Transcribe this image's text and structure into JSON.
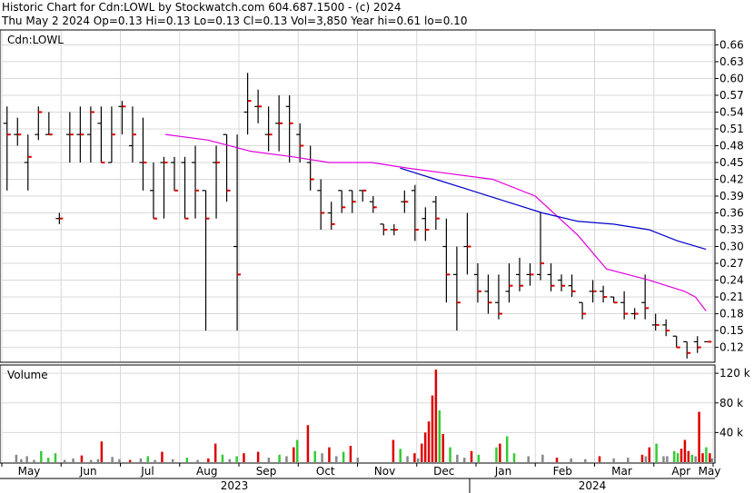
{
  "header": {
    "line1": "Historic Chart for Cdn:LOWL by Stockwatch.com 604.687.1500 - (c) 2024",
    "line2": "Thu May  2 2024  Op=0.13  Hi=0.13  Lo=0.13  Cl=0.13  Vol=3,850  Year hi=0.61  lo=0.10"
  },
  "colors": {
    "background": "#ffffff",
    "grid": "#d8d8d8",
    "price_bar": "#000000",
    "close_tick": "#dd0000",
    "ma_short": "#e000e0",
    "ma_long": "#0000cc",
    "volume_up": "#33cc33",
    "volume_down": "#dd0000",
    "volume_flat": "#888888"
  },
  "chart_data": [
    {
      "type": "ohlc",
      "title": "Cdn:LOWL",
      "y_axis_side": "right",
      "ylim": [
        0.095,
        0.685
      ],
      "y_ticks": [
        "0.66",
        "0.63",
        "0.60",
        "0.57",
        "0.54",
        "0.51",
        "0.48",
        "0.45",
        "0.42",
        "0.39",
        "0.36",
        "0.33",
        "0.30",
        "0.27",
        "0.24",
        "0.21",
        "0.18",
        "0.15",
        "0.12"
      ],
      "grid": true,
      "x_months": [
        "May",
        "Jun",
        "Jul",
        "Aug",
        "Sep",
        "Oct",
        "Nov",
        "Dec",
        "Jan",
        "Feb",
        "Mar",
        "Apr",
        "May"
      ],
      "x_years": [
        "2023",
        "2024"
      ],
      "ohlc": [
        [
          0.52,
          0.55,
          0.4,
          0.5
        ],
        [
          0.5,
          0.53,
          0.48,
          0.5
        ],
        [
          0.45,
          0.5,
          0.4,
          0.46
        ],
        [
          0.5,
          0.55,
          0.49,
          0.54
        ],
        [
          0.5,
          0.54,
          0.5,
          0.5
        ],
        [
          0.35,
          0.36,
          0.34,
          0.35
        ],
        [
          0.5,
          0.54,
          0.45,
          0.5
        ],
        [
          0.5,
          0.55,
          0.45,
          0.5
        ],
        [
          0.5,
          0.55,
          0.45,
          0.54
        ],
        [
          0.52,
          0.55,
          0.45,
          0.45
        ],
        [
          0.45,
          0.55,
          0.45,
          0.5
        ],
        [
          0.55,
          0.56,
          0.5,
          0.55
        ],
        [
          0.48,
          0.55,
          0.45,
          0.5
        ],
        [
          0.45,
          0.53,
          0.4,
          0.45
        ],
        [
          0.4,
          0.45,
          0.35,
          0.35
        ],
        [
          0.45,
          0.46,
          0.35,
          0.45
        ],
        [
          0.45,
          0.46,
          0.4,
          0.4
        ],
        [
          0.45,
          0.46,
          0.35,
          0.35
        ],
        [
          0.45,
          0.48,
          0.35,
          0.4
        ],
        [
          0.4,
          0.4,
          0.15,
          0.35
        ],
        [
          0.45,
          0.48,
          0.35,
          0.45
        ],
        [
          0.5,
          0.5,
          0.38,
          0.4
        ],
        [
          0.3,
          0.5,
          0.15,
          0.25
        ],
        [
          0.54,
          0.61,
          0.5,
          0.56
        ],
        [
          0.55,
          0.58,
          0.52,
          0.55
        ],
        [
          0.5,
          0.55,
          0.47,
          0.5
        ],
        [
          0.52,
          0.57,
          0.47,
          0.52
        ],
        [
          0.55,
          0.57,
          0.45,
          0.52
        ],
        [
          0.5,
          0.52,
          0.45,
          0.48
        ],
        [
          0.45,
          0.48,
          0.4,
          0.42
        ],
        [
          0.4,
          0.42,
          0.33,
          0.36
        ],
        [
          0.36,
          0.38,
          0.33,
          0.34
        ],
        [
          0.4,
          0.4,
          0.36,
          0.37
        ],
        [
          0.4,
          0.4,
          0.36,
          0.38
        ],
        [
          0.4,
          0.4,
          0.38,
          0.4
        ],
        [
          0.38,
          0.39,
          0.36,
          0.37
        ],
        [
          0.34,
          0.34,
          0.32,
          0.33
        ],
        [
          0.33,
          0.34,
          0.32,
          0.33
        ],
        [
          0.38,
          0.4,
          0.36,
          0.38
        ],
        [
          0.4,
          0.41,
          0.31,
          0.33
        ],
        [
          0.35,
          0.37,
          0.31,
          0.33
        ],
        [
          0.38,
          0.39,
          0.33,
          0.35
        ],
        [
          0.3,
          0.35,
          0.2,
          0.25
        ],
        [
          0.25,
          0.3,
          0.15,
          0.2
        ],
        [
          0.3,
          0.36,
          0.25,
          0.3
        ],
        [
          0.25,
          0.27,
          0.2,
          0.22
        ],
        [
          0.22,
          0.25,
          0.18,
          0.2
        ],
        [
          0.2,
          0.25,
          0.17,
          0.18
        ],
        [
          0.22,
          0.27,
          0.2,
          0.23
        ],
        [
          0.25,
          0.28,
          0.22,
          0.23
        ],
        [
          0.25,
          0.27,
          0.23,
          0.25
        ],
        [
          0.25,
          0.36,
          0.24,
          0.27
        ],
        [
          0.25,
          0.27,
          0.22,
          0.23
        ],
        [
          0.24,
          0.25,
          0.22,
          0.23
        ],
        [
          0.23,
          0.25,
          0.21,
          0.22
        ],
        [
          0.2,
          0.2,
          0.17,
          0.18
        ],
        [
          0.22,
          0.24,
          0.2,
          0.22
        ],
        [
          0.22,
          0.23,
          0.2,
          0.21
        ],
        [
          0.21,
          0.21,
          0.2,
          0.2
        ],
        [
          0.2,
          0.22,
          0.17,
          0.18
        ],
        [
          0.18,
          0.19,
          0.17,
          0.18
        ],
        [
          0.2,
          0.25,
          0.17,
          0.19
        ],
        [
          0.16,
          0.18,
          0.15,
          0.16
        ],
        [
          0.16,
          0.17,
          0.14,
          0.15
        ],
        [
          0.14,
          0.14,
          0.12,
          0.12
        ],
        [
          0.13,
          0.13,
          0.1,
          0.11
        ],
        [
          0.13,
          0.14,
          0.11,
          0.12
        ],
        [
          0.13,
          0.13,
          0.13,
          0.13
        ]
      ],
      "ma_short": [
        [
          0.23,
          0.5
        ],
        [
          0.29,
          0.49
        ],
        [
          0.35,
          0.47
        ],
        [
          0.41,
          0.46
        ],
        [
          0.46,
          0.45
        ],
        [
          0.52,
          0.45
        ],
        [
          0.57,
          0.44
        ],
        [
          0.63,
          0.43
        ],
        [
          0.69,
          0.42
        ],
        [
          0.75,
          0.39
        ],
        [
          0.81,
          0.32
        ],
        [
          0.85,
          0.26
        ],
        [
          0.91,
          0.24
        ],
        [
          0.96,
          0.22
        ],
        [
          0.975,
          0.21
        ],
        [
          0.99,
          0.185
        ]
      ],
      "ma_long": [
        [
          0.56,
          0.44
        ],
        [
          0.61,
          0.42
        ],
        [
          0.66,
          0.4
        ],
        [
          0.71,
          0.38
        ],
        [
          0.76,
          0.36
        ],
        [
          0.81,
          0.345
        ],
        [
          0.86,
          0.34
        ],
        [
          0.91,
          0.33
        ],
        [
          0.95,
          0.31
        ],
        [
          0.99,
          0.295
        ]
      ]
    },
    {
      "type": "bar",
      "title": "Volume",
      "y_axis_side": "right",
      "ylim": [
        0,
        130000
      ],
      "y_ticks": [
        "120 k",
        "80 k",
        "40 k"
      ],
      "grid": true,
      "values": [
        10000,
        4000,
        8000,
        3000,
        15000,
        6000,
        12000,
        3000,
        5000,
        9000,
        3000,
        4000,
        28000,
        7000,
        4000,
        3000,
        5000,
        8000,
        3000,
        14000,
        4000,
        6000,
        3000,
        5000,
        25000,
        10000,
        4000,
        8000,
        12000,
        14000,
        6000,
        10000,
        8000,
        20000,
        30000,
        50000,
        15000,
        12000,
        20000,
        8000,
        14000,
        22000,
        6000,
        30000,
        18000,
        8000,
        12000,
        5000,
        25000,
        40000,
        55000,
        90000,
        125000,
        70000,
        38000,
        20000,
        10000,
        6000,
        15000,
        10000,
        20000,
        25000,
        35000,
        12000,
        8000,
        10000,
        6000,
        5000,
        4000,
        8000,
        5000,
        6000,
        10000,
        8000,
        20000,
        25000,
        8000,
        12000,
        30000,
        15000,
        10000,
        8000,
        68000,
        12000,
        20000,
        12000,
        5000,
        18000,
        15000,
        8000
      ],
      "x_frac": [
        0.02,
        0.027,
        0.035,
        0.045,
        0.055,
        0.065,
        0.075,
        0.088,
        0.1,
        0.112,
        0.125,
        0.135,
        0.14,
        0.155,
        0.165,
        0.18,
        0.195,
        0.205,
        0.215,
        0.225,
        0.24,
        0.26,
        0.275,
        0.29,
        0.3,
        0.31,
        0.32,
        0.33,
        0.34,
        0.36,
        0.375,
        0.39,
        0.4,
        0.41,
        0.415,
        0.43,
        0.44,
        0.45,
        0.46,
        0.47,
        0.48,
        0.49,
        0.5,
        0.55,
        0.56,
        0.57,
        0.58,
        0.585,
        0.59,
        0.595,
        0.6,
        0.605,
        0.61,
        0.615,
        0.62,
        0.63,
        0.64,
        0.65,
        0.66,
        0.67,
        0.695,
        0.7,
        0.71,
        0.72,
        0.74,
        0.76,
        0.78,
        0.8,
        0.82,
        0.84,
        0.86,
        0.88,
        0.9,
        0.905,
        0.91,
        0.92,
        0.93,
        0.95,
        0.96,
        0.965,
        0.97,
        0.975,
        0.98,
        0.985,
        0.99,
        0.995,
        0.998,
        0.955,
        0.945,
        0.935
      ],
      "kind": [
        "flat",
        "flat",
        "flat",
        "flat",
        "up",
        "up",
        "up",
        "flat",
        "flat",
        "down",
        "flat",
        "flat",
        "down",
        "flat",
        "flat",
        "down",
        "flat",
        "up",
        "flat",
        "down",
        "flat",
        "up",
        "flat",
        "down",
        "down",
        "up",
        "flat",
        "up",
        "down",
        "down",
        "flat",
        "up",
        "flat",
        "down",
        "up",
        "down",
        "up",
        "flat",
        "down",
        "flat",
        "up",
        "down",
        "flat",
        "down",
        "up",
        "flat",
        "down",
        "flat",
        "down",
        "down",
        "down",
        "down",
        "down",
        "up",
        "down",
        "up",
        "flat",
        "flat",
        "down",
        "up",
        "up",
        "down",
        "up",
        "up",
        "flat",
        "flat",
        "down",
        "flat",
        "flat",
        "down",
        "flat",
        "flat",
        "down",
        "flat",
        "down",
        "up",
        "flat",
        "up",
        "down",
        "down",
        "up",
        "flat",
        "down",
        "down",
        "up",
        "down",
        "flat",
        "down",
        "up",
        "flat"
      ]
    }
  ]
}
